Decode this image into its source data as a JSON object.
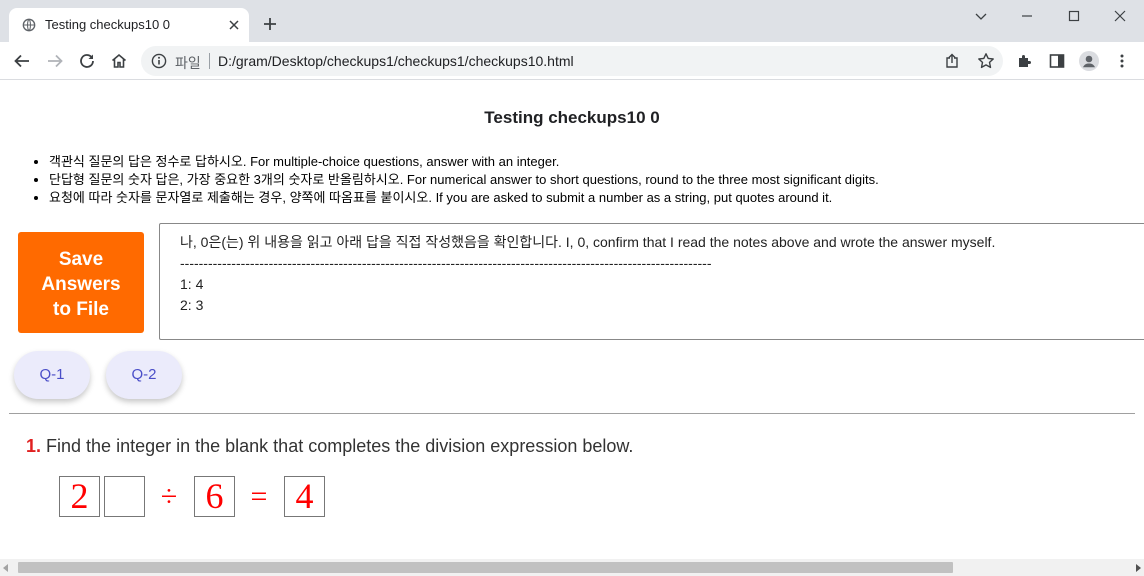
{
  "browser": {
    "tab_title": "Testing checkups10 0",
    "address_scheme": "파일",
    "address_url": "D:/gram/Desktop/checkups1/checkups1/checkups10.html"
  },
  "page": {
    "title": "Testing checkups10 0",
    "instructions": [
      "객관식 질문의 답은 정수로 답하시오. For multiple-choice questions, answer with an integer.",
      "단답형 질문의 숫자 답은, 가장 중요한 3개의 숫자로 반올림하시오. For numerical answer to short questions, round to the three most significant digits.",
      "요청에 따라 숫자를 문자열로 제출해는 경우, 양쪽에 따옴표를 붙이시오. If you are asked to submit a number as a string, put quotes around it."
    ],
    "save_button": {
      "line1": "Save",
      "line2": "Answers",
      "line3": "to File"
    },
    "answer_box": {
      "confirm_text": "나, 0은(는) 위 내용을 읽고 아래 답을 직접 작성했음을 확인합니다. I, 0, confirm that I read the notes above and wrote the answer myself.",
      "separator": "------------------------------------------------------------------------------------------------------------------",
      "answers": [
        "1: 4",
        "2: 3"
      ]
    },
    "question_buttons": [
      "Q-1",
      "Q-2"
    ],
    "question": {
      "number": "1.",
      "text": "Find the integer in the blank that completes the division expression below.",
      "expression": {
        "dividend_first_digit": "2",
        "dividend_blank": "",
        "divide_symbol": "÷",
        "divisor": "6",
        "equals_symbol": "=",
        "quotient": "4"
      }
    }
  },
  "colors": {
    "save_button": "#ff6a00",
    "question_button_bg": "#ebebfb",
    "question_button_text": "#4a4ec8",
    "question_number": "#e02020",
    "expression": "#ff0000"
  },
  "icons": [
    "globe-icon",
    "close-icon",
    "plus-icon",
    "chevron-down-icon",
    "minimize-icon",
    "maximize-icon",
    "window-close-icon",
    "back-arrow-icon",
    "forward-arrow-icon",
    "reload-icon",
    "home-icon",
    "info-icon",
    "share-icon",
    "star-icon",
    "puzzle-icon",
    "sidebar-icon",
    "profile-icon",
    "kebab-menu-icon"
  ]
}
